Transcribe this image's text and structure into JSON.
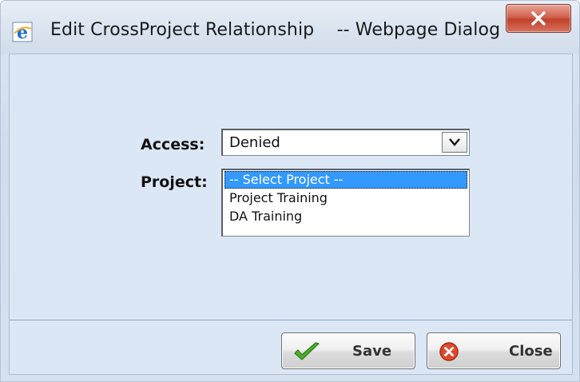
{
  "window": {
    "title": "Edit CrossProject Relationship    -- Webpage Dialog",
    "title_icon": "ie-icon",
    "close_icon": "close-x-icon"
  },
  "form": {
    "access_label": "Access:",
    "access_value": "Denied",
    "project_label": "Project:",
    "project_options": [
      {
        "label": "-- Select Project --",
        "selected": true
      },
      {
        "label": "Project Training",
        "selected": false
      },
      {
        "label": "DA Training",
        "selected": false
      }
    ]
  },
  "buttons": {
    "save_label": "Save",
    "save_icon": "checkmark-icon",
    "close_label": "Close",
    "close_icon": "red-x-circle-icon"
  },
  "colors": {
    "dialog_background": "#dce7f6",
    "selection": "#3399ff",
    "close_button": "#c2412b"
  }
}
